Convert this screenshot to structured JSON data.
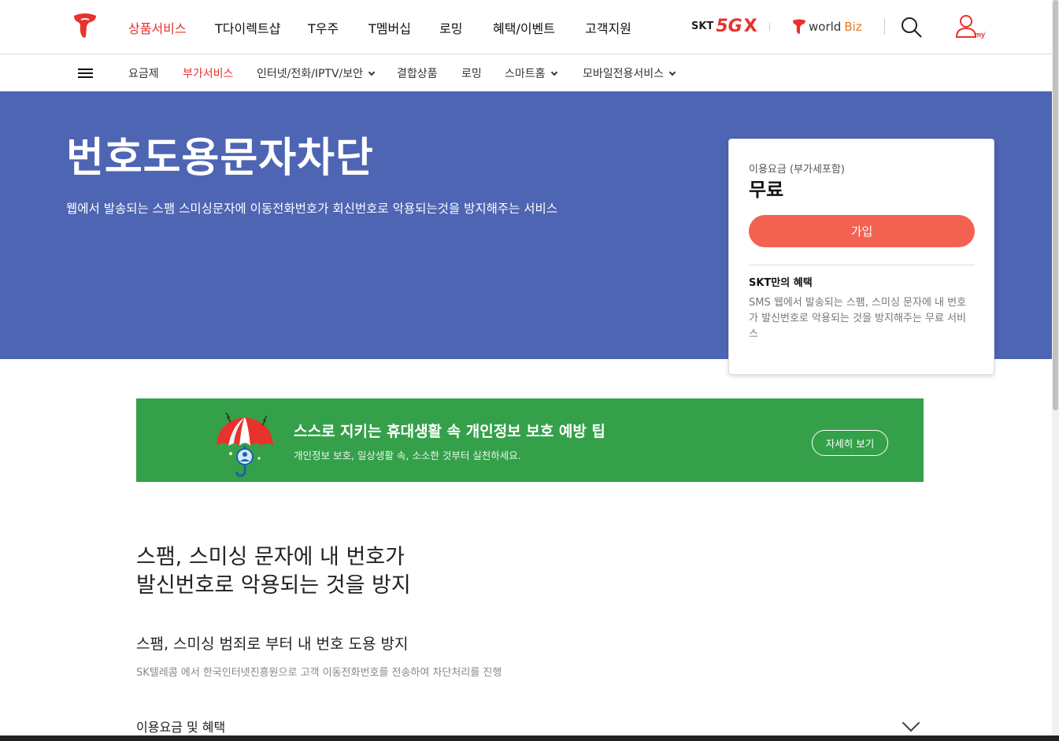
{
  "header": {
    "logo_icon": "t-logo-icon",
    "gnb": [
      "상품서비스",
      "T다이렉트샵",
      "T우주",
      "T멤버십",
      "로밍",
      "혜택/이벤트",
      "고객지원"
    ],
    "gnb_active_index": 0,
    "brand_5gx": {
      "skt": "SKT",
      "fiveg": "5G",
      "x": "X"
    },
    "worldbiz": {
      "world": "world",
      "biz": "Biz"
    },
    "search_icon": "search-icon",
    "myt_label": "myT"
  },
  "subnav": {
    "menu_icon": "hamburger-icon",
    "items": [
      {
        "label": "요금제",
        "dropdown": false
      },
      {
        "label": "부가서비스",
        "dropdown": false,
        "active": true
      },
      {
        "label": "인터넷/전화/IPTV/보안",
        "dropdown": true
      },
      {
        "label": "결합상품",
        "dropdown": false
      },
      {
        "label": "로밍",
        "dropdown": false
      },
      {
        "label": "스마트홈",
        "dropdown": true
      },
      {
        "label": "모바일전용서비스",
        "dropdown": true
      }
    ]
  },
  "hero": {
    "title": "번호도용문자차단",
    "description": "웹에서 발송되는 스팸 스미싱문자에 이동전화번호가 회신번호로 악용되는것을 방지해주는 서비스",
    "bg_color": "#4e65b4"
  },
  "price_card": {
    "fee_label": "이용요금 (부가세포함)",
    "fee_value": "무료",
    "join_button": "가입",
    "benefit_title": "SKT만의 혜택",
    "benefit_desc": "SMS 웹에서 발송되는 스팸, 스미싱 문자에 내 번호가 발신번호로 악용되는 것을 방지해주는 무료 서비스",
    "accent_color": "#f36150"
  },
  "banner": {
    "title": "스스로 지키는 휴대생활 속 개인정보 보호 예방 팁",
    "subtitle": "개인정보 보호, 일상생활 속, 소소한 것부터 실천하세요.",
    "button": "자세히 보기",
    "icon": "umbrella-icon",
    "bg_color": "#35a04a"
  },
  "content": {
    "headline_line1": "스팸, 스미싱 문자에 내 번호가",
    "headline_line2": "발신번호로 악용되는 것을 방지",
    "sub_heading": "스팸, 스미싱 범죄로 부터 내 번호 도용 방지",
    "sub_desc": "SK텔레콤 에서 한국인터넷진흥원으로 고객 이동전화번호를 전송하여 차단처리를 진행",
    "accordion_label": "이용요금 및 혜택"
  }
}
